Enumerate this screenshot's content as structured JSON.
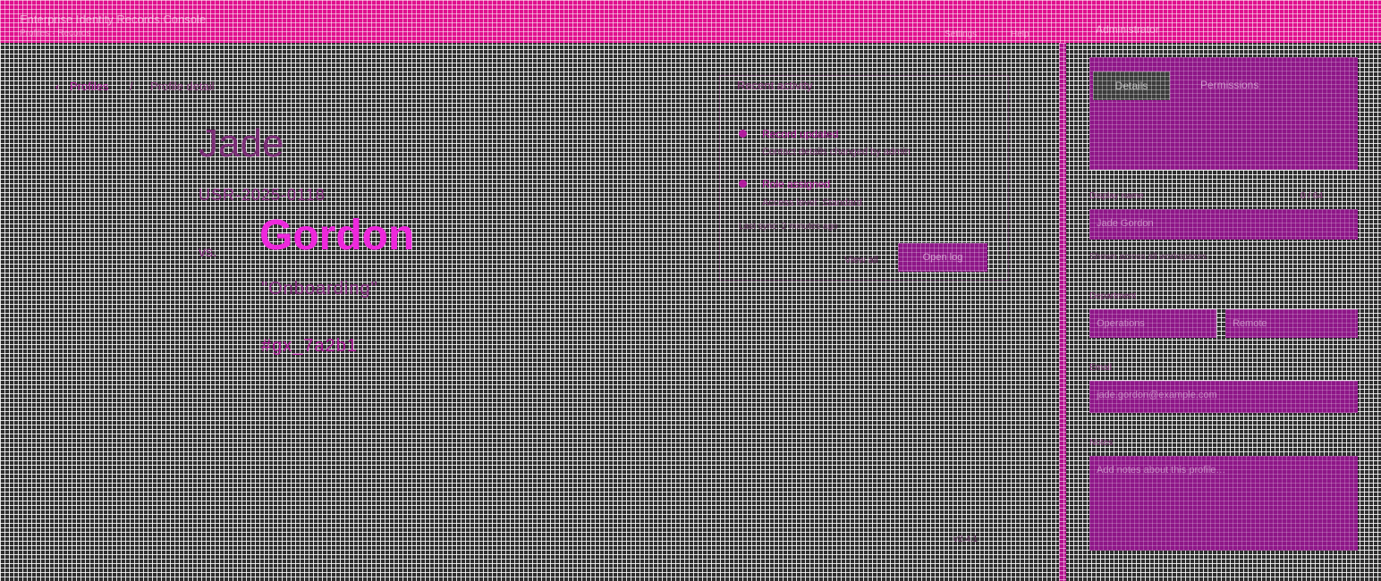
{
  "header": {
    "title": "Enterprise Identity Records Console",
    "subtitle": "Profiles · Records",
    "nav_a": "Settings",
    "nav_b": "Help",
    "user": "Administrator"
  },
  "breadcrumb": {
    "root": "Profiles",
    "separator": "/",
    "current": "Profile detail"
  },
  "profile": {
    "first_name": "Jade",
    "id_line": "USR-2025-0118",
    "vs_label": "vs.",
    "last_name": "Gordon",
    "quote": "\"Onboarding\"",
    "hash": "#gx_7a2b1"
  },
  "info_card": {
    "title": "Recent activity",
    "items": [
      {
        "title": "Record updated",
        "subtitle": "Contact details changed by admin"
      },
      {
        "title": "Role assigned",
        "subtitle": "Access level: Standard"
      }
    ],
    "meta": "Last sync: 2 minutes ago",
    "meta2": "View all",
    "button": "Open log"
  },
  "footer": {
    "note": "v2.4.1"
  },
  "right_panel": {
    "tab_active": "Details",
    "tab_other": "Permissions",
    "label_1": "Display name",
    "count": "0 / 64",
    "field_1": "Jade Gordon",
    "help_1": "Shown across all workspaces",
    "label_2": "Department",
    "field_2a": "Operations",
    "field_2b": "Remote",
    "label_3": "Email",
    "field_3": "jade.gordon@example.com",
    "label_4": "Notes",
    "field_4": "Add notes about this profile…"
  },
  "colors": {
    "accent": "#e0108e",
    "accent_dark": "#8e1688",
    "highlight": "#ee28dc",
    "background": "#2e2e2e"
  },
  "icons": {
    "breadcrumb": "chevron-left-icon",
    "bullet": "dot-icon"
  }
}
